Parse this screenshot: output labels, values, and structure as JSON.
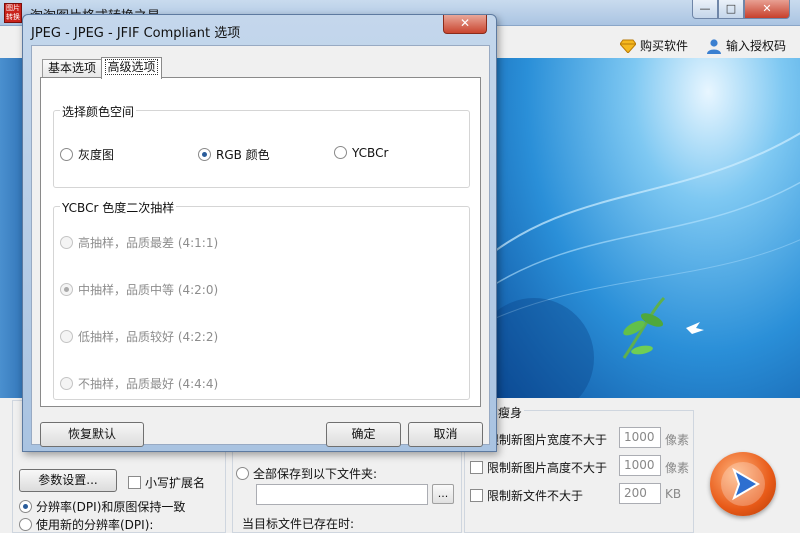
{
  "main_window": {
    "title": "淘淘图片格式转换之星",
    "app_icon_text": "图片转换",
    "buttons": {
      "minimize": "—",
      "maximize": "□",
      "close": "✕"
    },
    "links": {
      "buy": "购买软件",
      "register": "输入授权码"
    },
    "left_panel": {
      "params_button": "参数设置...",
      "lowercase_ext": "小写扩展名",
      "dpi_keep": "分辨率(DPI)和原图保持一致",
      "dpi_new": "使用新的分辨率(DPI):"
    },
    "middle_panel": {
      "save_all_to_folder": "全部保存到以下文件夹:",
      "folder_path": "",
      "browse": "...",
      "when_exists": "当目标文件已存在时:"
    },
    "right_panel": {
      "title": "瘦身",
      "limit_width": "限制新图片宽度不大于",
      "limit_height": "限制新图片高度不大于",
      "limit_size": "限制新文件不大于",
      "width_value": "1000",
      "height_value": "1000",
      "size_value": "200",
      "unit_px": "像素",
      "unit_kb": "KB"
    }
  },
  "dialog": {
    "title": "JPEG - JPEG - JFIF Compliant 选项",
    "close": "✕",
    "tabs": [
      {
        "label": "基本选项"
      },
      {
        "label": "高级选项"
      }
    ],
    "color_space": {
      "title": "选择颜色空间",
      "options": [
        "灰度图",
        "RGB 颜色",
        "YCBCr"
      ],
      "selected": "RGB 颜色"
    },
    "subsampling": {
      "title": "YCBCr 色度二次抽样",
      "options": [
        "高抽样，品质最差 (4:1:1)",
        "中抽样，品质中等 (4:2:0)",
        "低抽样，品质较好 (4:2:2)",
        "不抽样，品质最好 (4:4:4)"
      ],
      "selected": "中抽样，品质中等 (4:2:0)"
    },
    "buttons": {
      "restore": "恢复默认",
      "ok": "确定",
      "cancel": "取消"
    }
  },
  "colors": {
    "accent": "#2a5c9a",
    "close_red": "#c9452f",
    "titlebar": "#aac4e2"
  }
}
